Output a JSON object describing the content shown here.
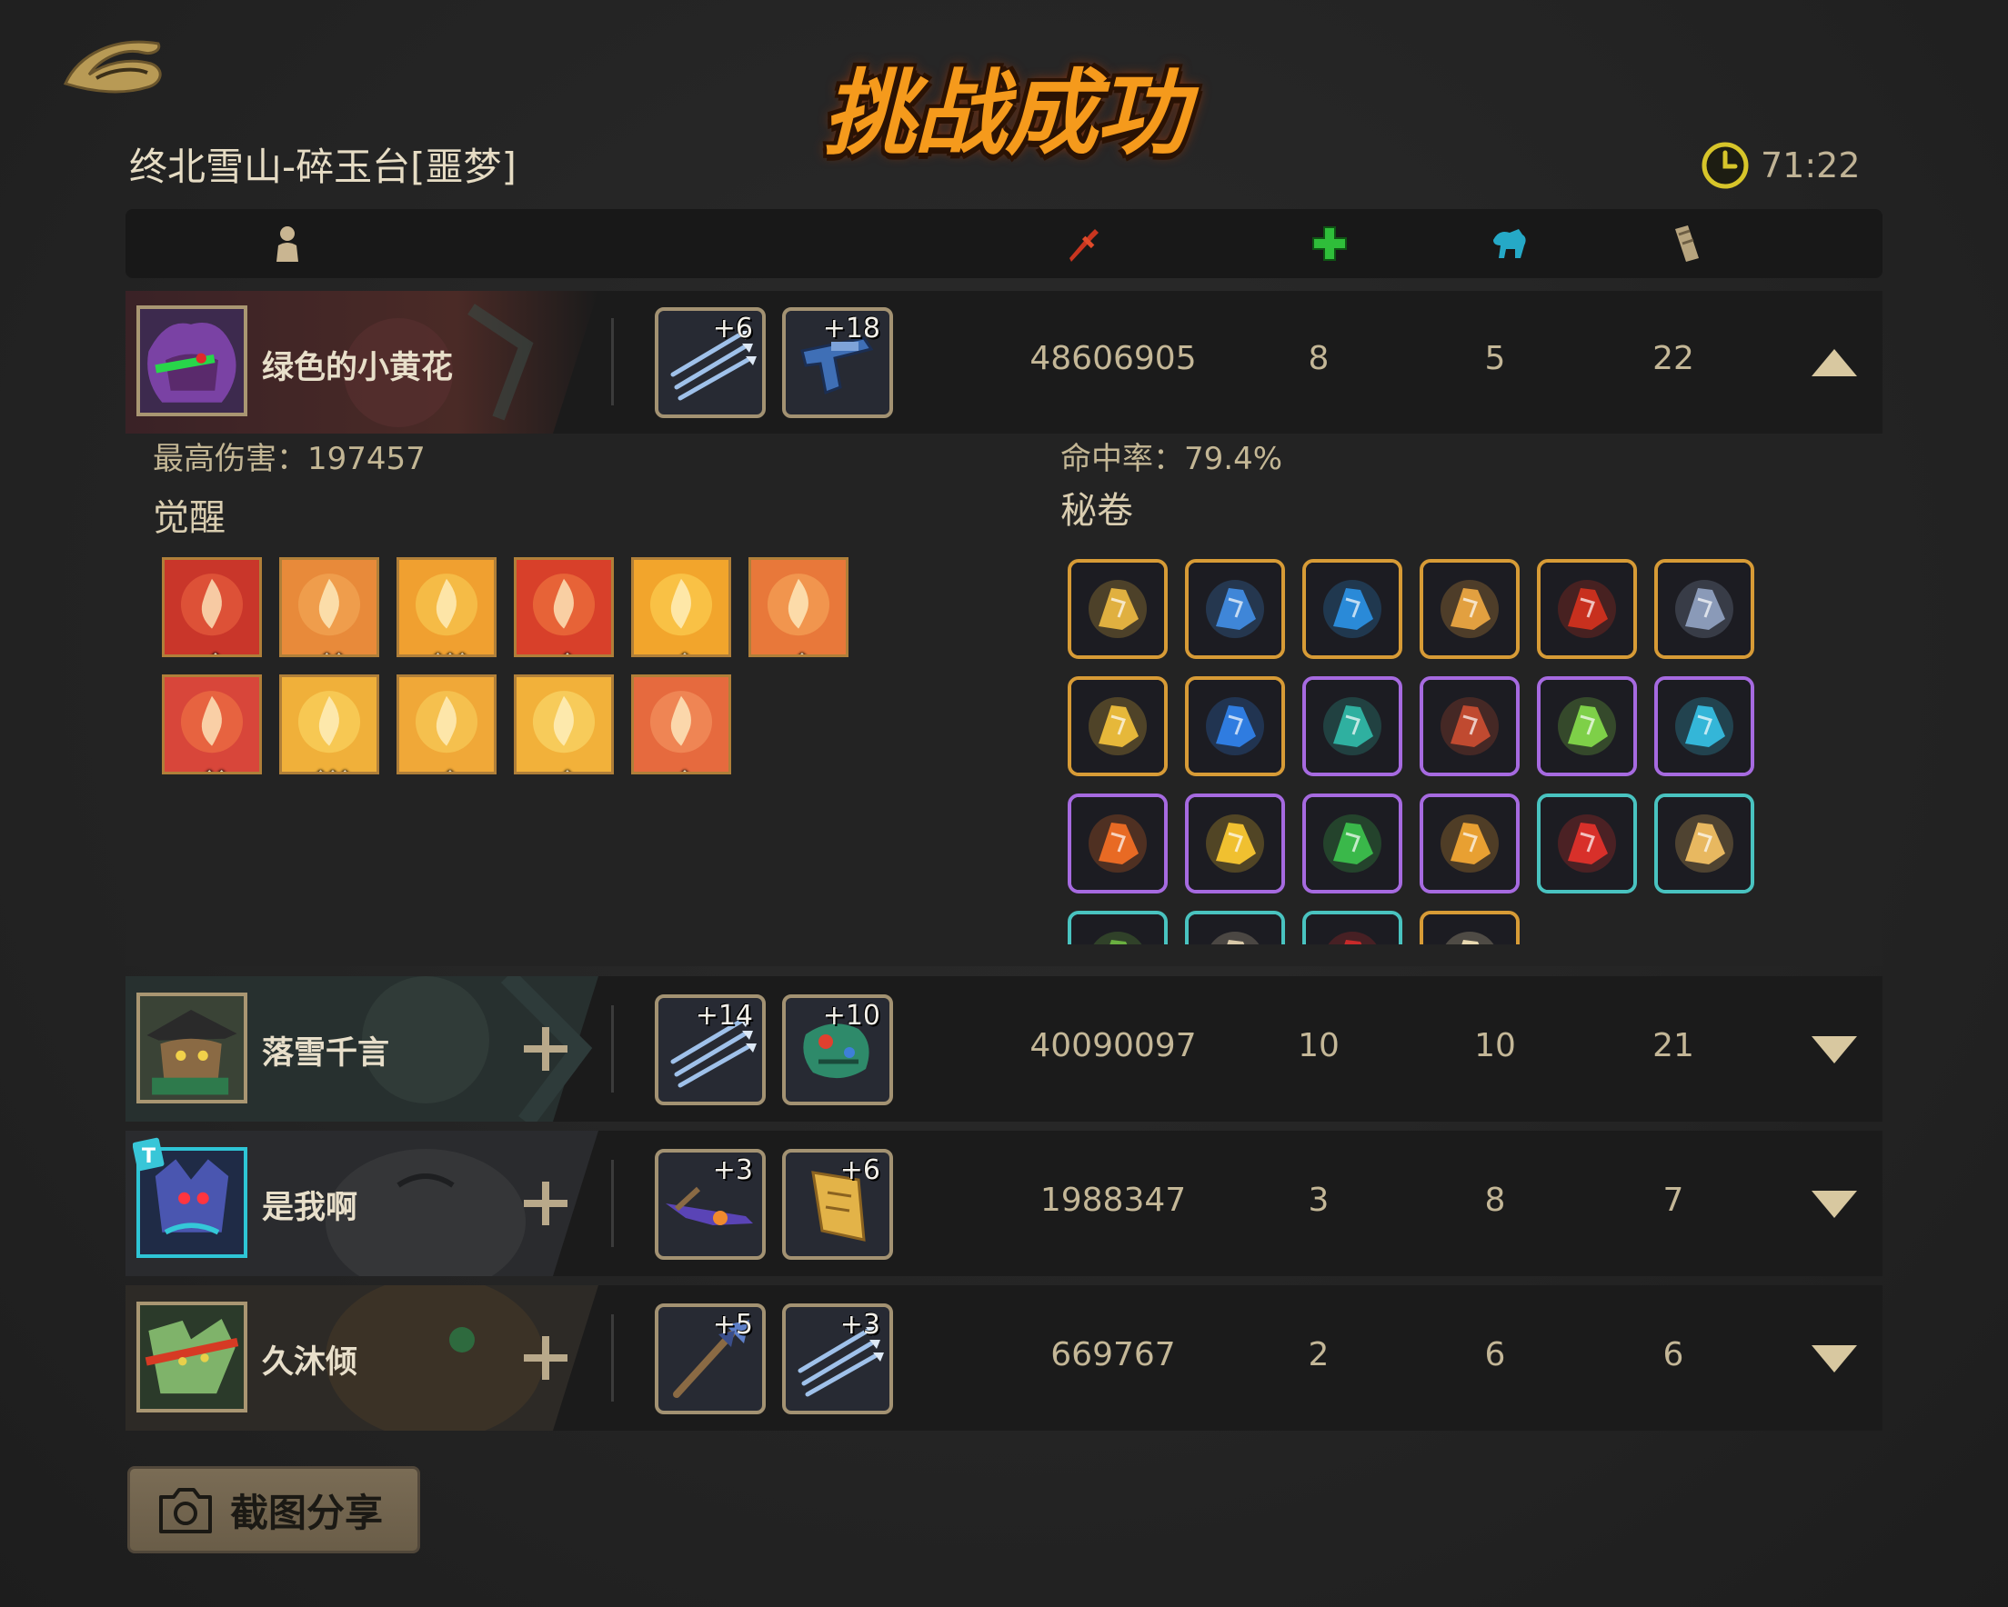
{
  "title": "挑战成功",
  "stage": "终北雪山-碎玉台[噩梦]",
  "timer": {
    "icon": "clock-icon",
    "value": "71:22"
  },
  "header_icons": [
    "player-icon",
    "damage-icon",
    "heal-icon",
    "revive-icon",
    "scroll-icon"
  ],
  "players": [
    {
      "name": "绿色的小黄花",
      "weapons": [
        {
          "icon": "triple-dart-icon",
          "level": "+6"
        },
        {
          "icon": "pistol-icon",
          "level": "+18"
        }
      ],
      "damage": "48606905",
      "heal": "8",
      "revive": "5",
      "scrolls": "22",
      "expanded": true,
      "show_add": false
    },
    {
      "name": "落雪千言",
      "weapons": [
        {
          "icon": "triple-dart-icon",
          "level": "+14"
        },
        {
          "icon": "creature-weapon-icon",
          "level": "+10"
        }
      ],
      "damage": "40090097",
      "heal": "10",
      "revive": "10",
      "scrolls": "21",
      "expanded": false,
      "show_add": true
    },
    {
      "name": "是我啊",
      "weapons": [
        {
          "icon": "rifle-icon",
          "level": "+3"
        },
        {
          "icon": "talisman-icon",
          "level": "+6"
        }
      ],
      "damage": "1988347",
      "heal": "3",
      "revive": "8",
      "scrolls": "7",
      "expanded": false,
      "show_add": true
    },
    {
      "name": "久沐倾",
      "weapons": [
        {
          "icon": "spear-icon",
          "level": "+5"
        },
        {
          "icon": "triple-dart-icon",
          "level": "+3"
        }
      ],
      "damage": "669767",
      "heal": "2",
      "revive": "6",
      "scrolls": "6",
      "expanded": false,
      "show_add": true
    }
  ],
  "details": {
    "max_damage_label": "最高伤害：",
    "max_damage_value": "197457",
    "hit_rate_label": "命中率：",
    "hit_rate_value": "79.4%",
    "awakening_title": "觉醒",
    "secret_scroll_title": "秘卷",
    "awakenings": [
      {
        "icon": "fox-mask-icon",
        "stars": 1
      },
      {
        "icon": "fire-swirl-icon",
        "stars": 2
      },
      {
        "icon": "flame-orb-icon",
        "stars": 3
      },
      {
        "icon": "flame-burst-icon",
        "stars": 1
      },
      {
        "icon": "fire-crest-icon",
        "stars": 1
      },
      {
        "icon": "fire-spirit-icon",
        "stars": 1
      },
      {
        "icon": "fire-face-icon",
        "stars": 2
      },
      {
        "icon": "fire-scroll-icon",
        "stars": 3
      },
      {
        "icon": "fire-feather-icon",
        "stars": 1
      },
      {
        "icon": "fire-torch-icon",
        "stars": 1
      },
      {
        "icon": "fire-cat-icon",
        "stars": 1
      }
    ],
    "scrolls": [
      {
        "icon": "gold-crest-icon",
        "rarity": "gold"
      },
      {
        "icon": "blue-cat-icon",
        "rarity": "gold"
      },
      {
        "icon": "blue-shield-icon",
        "rarity": "gold"
      },
      {
        "icon": "gold-book-icon",
        "rarity": "gold"
      },
      {
        "icon": "red-slash-icon",
        "rarity": "gold"
      },
      {
        "icon": "stone-head-icon",
        "rarity": "gold"
      },
      {
        "icon": "gold-coins-icon",
        "rarity": "gold"
      },
      {
        "icon": "blue-armor-icon",
        "rarity": "gold"
      },
      {
        "icon": "heal-shield-icon",
        "rarity": "purple"
      },
      {
        "icon": "hammer-icon",
        "rarity": "purple"
      },
      {
        "icon": "green-nut-icon",
        "rarity": "purple"
      },
      {
        "icon": "cyan-boot-icon",
        "rarity": "purple"
      },
      {
        "icon": "fire-ring-icon",
        "rarity": "purple"
      },
      {
        "icon": "spark-orb-icon",
        "rarity": "purple"
      },
      {
        "icon": "green-ghost-icon",
        "rarity": "purple"
      },
      {
        "icon": "explosion-icon",
        "rarity": "purple"
      },
      {
        "icon": "red-fist-icon",
        "rarity": "teal"
      },
      {
        "icon": "candle-icon",
        "rarity": "teal"
      },
      {
        "icon": "green-sprout-icon",
        "rarity": "teal"
      },
      {
        "icon": "claw-icon",
        "rarity": "teal"
      },
      {
        "icon": "red-flame-icon",
        "rarity": "teal"
      },
      {
        "icon": "gold-dust-icon",
        "rarity": "gold"
      }
    ]
  },
  "share_button": {
    "icon": "camera-icon",
    "label": "截图分享"
  }
}
